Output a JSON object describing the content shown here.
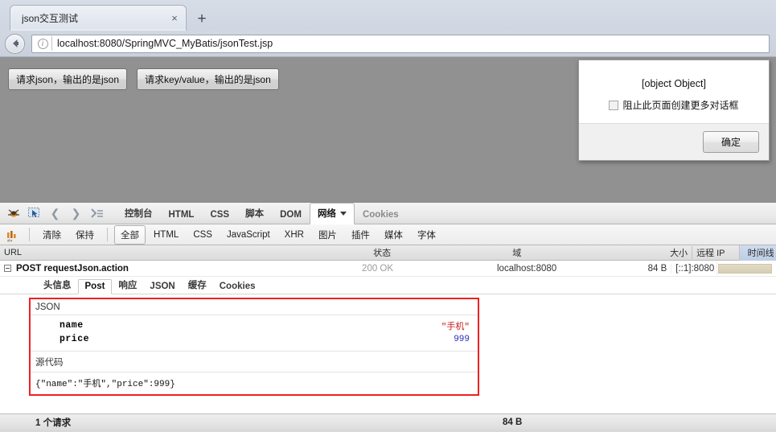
{
  "browser": {
    "tab": {
      "title": "json交互测试",
      "close_label": "×"
    },
    "newtab_label": "+",
    "back_label": "←",
    "ident_label": "i",
    "url": "localhost:8080/SpringMVC_MyBatis/jsonTest.jsp"
  },
  "page": {
    "background_color": "#919191",
    "buttons": [
      {
        "label": "请求json，输出的是json"
      },
      {
        "label": "请求key/value，输出的是json"
      }
    ],
    "dialog": {
      "message": "[object Object]",
      "checkbox_label": "阻止此页面创建更多对话框",
      "checkbox_checked": false,
      "ok_label": "确定"
    }
  },
  "firebug": {
    "icons": [
      {
        "name": "firebug-bug-icon"
      },
      {
        "name": "inspect-element-icon"
      },
      {
        "name": "nav-back-icon",
        "glyph": "‹"
      },
      {
        "name": "nav-forward-icon",
        "glyph": "›"
      },
      {
        "name": "command-line-icon",
        "glyph": "›≡"
      }
    ],
    "tabs": [
      {
        "label": "控制台",
        "active": false,
        "dim": false
      },
      {
        "label": "HTML",
        "active": false,
        "dim": false
      },
      {
        "label": "CSS",
        "active": false,
        "dim": false
      },
      {
        "label": "脚本",
        "active": false,
        "dim": false
      },
      {
        "label": "DOM",
        "active": false,
        "dim": false
      },
      {
        "label": "网络",
        "active": true,
        "dim": false,
        "has_caret": true
      },
      {
        "label": "Cookies",
        "active": false,
        "dim": true
      }
    ],
    "actions": [
      {
        "label": "清除"
      },
      {
        "label": "保持"
      }
    ],
    "filters": [
      {
        "label": "全部",
        "active": true
      },
      {
        "label": "HTML",
        "active": false
      },
      {
        "label": "CSS",
        "active": false
      },
      {
        "label": "JavaScript",
        "active": false
      },
      {
        "label": "XHR",
        "active": false
      },
      {
        "label": "图片",
        "active": false
      },
      {
        "label": "插件",
        "active": false
      },
      {
        "label": "媒体",
        "active": false
      },
      {
        "label": "字体",
        "active": false
      }
    ],
    "net_columns": {
      "url": "URL",
      "status": "状态",
      "domain": "域",
      "size": "大小",
      "remote_ip": "远程 IP",
      "timeline": "时间线"
    },
    "net_rows": [
      {
        "method_url": "POST requestJson.action",
        "status": "200 OK",
        "domain": "localhost:8080",
        "size": "84 B",
        "remote_ip": "[::1]:8080"
      }
    ],
    "detail_tabs": [
      {
        "label": "头信息",
        "active": false
      },
      {
        "label": "Post",
        "active": true
      },
      {
        "label": "响应",
        "active": false
      },
      {
        "label": "JSON",
        "active": false
      },
      {
        "label": "缓存",
        "active": false
      },
      {
        "label": "Cookies",
        "active": false
      }
    ],
    "json_panel": {
      "section_label": "JSON",
      "rows": [
        {
          "key": "name",
          "value": "\"手机\"",
          "type": "string"
        },
        {
          "key": "price",
          "value": "999",
          "type": "number"
        }
      ],
      "source_label": "源代码",
      "source_code": "{\"name\":\"手机\",\"price\":999}",
      "highlight_color": "#ee2020"
    },
    "status_bar": {
      "requests": "1 个请求",
      "total_size": "84 B"
    }
  }
}
